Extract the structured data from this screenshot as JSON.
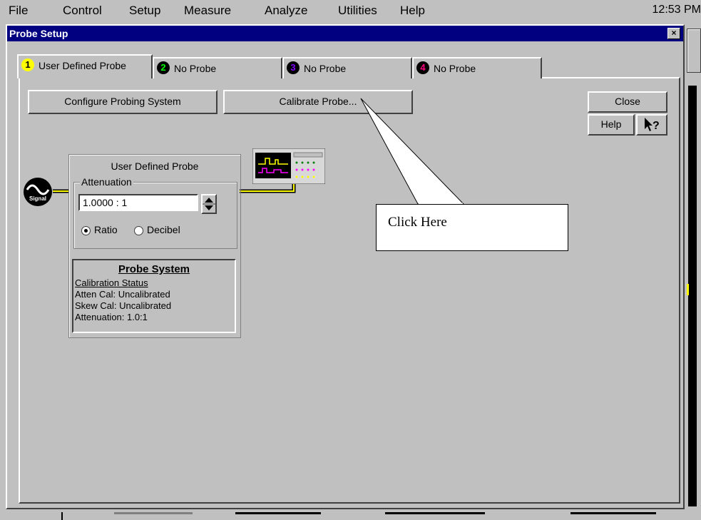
{
  "menubar": {
    "items": [
      "File",
      "Control",
      "Setup",
      "Measure",
      "Analyze",
      "Utilities",
      "Help"
    ],
    "clock": "12:53 PM"
  },
  "window": {
    "title": "Probe Setup",
    "close_glyph": "×"
  },
  "tabs": [
    {
      "num": "1",
      "label": "User Defined Probe",
      "color": "#ffff00"
    },
    {
      "num": "2",
      "label": "No Probe",
      "color": "#00ff00"
    },
    {
      "num": "3",
      "label": "No Probe",
      "color": "#8000ff"
    },
    {
      "num": "4",
      "label": "No Probe",
      "color": "#ff0080"
    }
  ],
  "buttons": {
    "configure": "Configure Probing System",
    "calibrate": "Calibrate Probe...",
    "close": "Close",
    "help": "Help",
    "whatsthis": "?"
  },
  "probe": {
    "title": "User Defined Probe",
    "attenuation_legend": "Attenuation",
    "attenuation_value": "1.0000  : 1",
    "ratio_label": "Ratio",
    "decibel_label": "Decibel",
    "selected_mode": "Ratio"
  },
  "probe_system": {
    "heading": "Probe System",
    "status_link": "Calibration Status",
    "atten_cal": "Atten Cal: Uncalibrated",
    "skew_cal": "Skew Cal: Uncalibrated",
    "attenuation": "Attenuation:    1.0:1"
  },
  "signal_label": "Signal",
  "callout": "Click Here",
  "colors": {
    "titlebar": "#000080",
    "cable": "#ffff00"
  }
}
